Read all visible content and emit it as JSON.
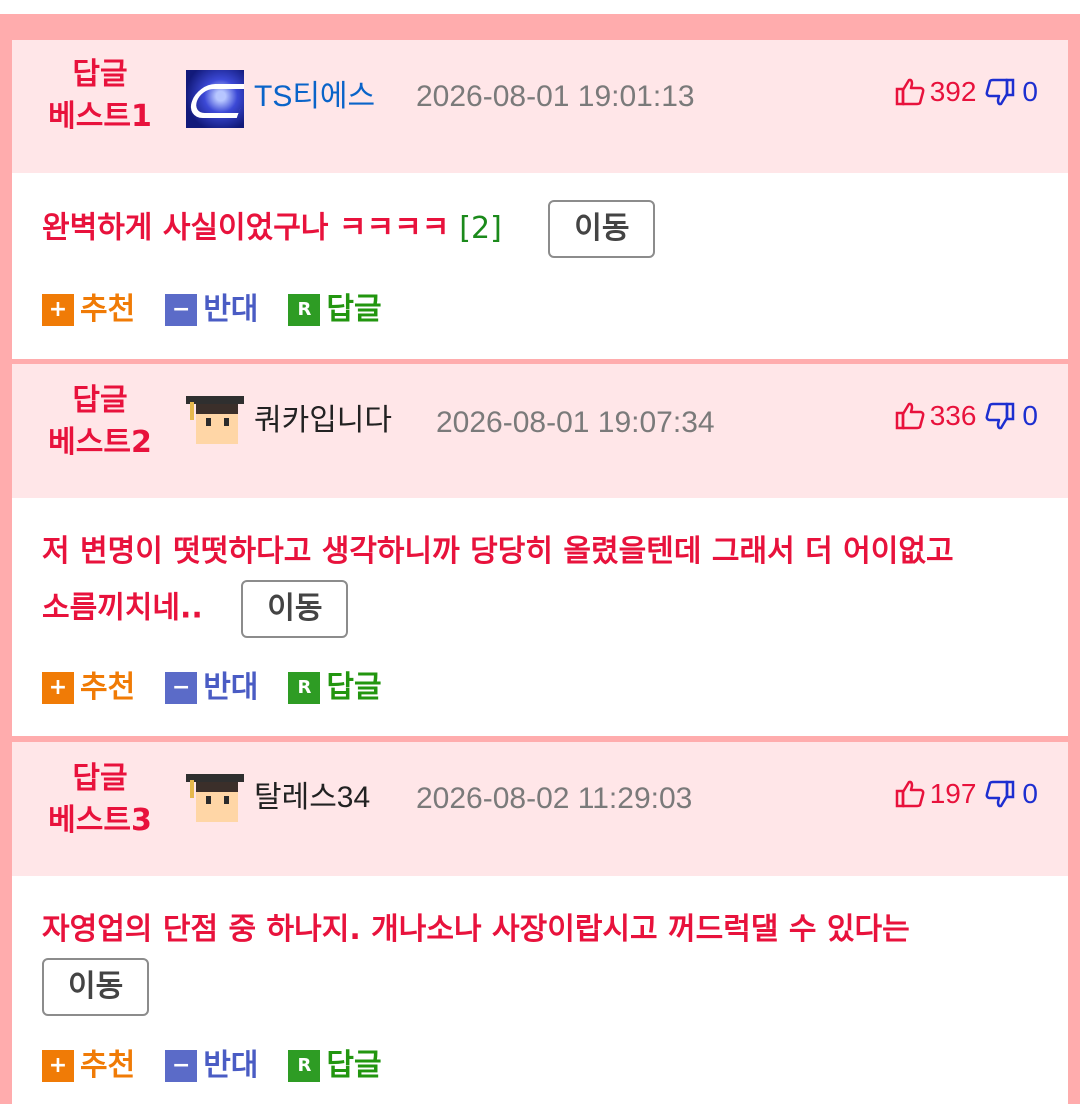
{
  "colors": {
    "frame": "#ffacad",
    "header_bg": "#ffe6e8",
    "accent_red": "#e8123c",
    "recommend": "#f07b06",
    "oppose": "#5b6bc8",
    "reply": "#2e9c24"
  },
  "comments": [
    {
      "best_line1": "답글",
      "best_line2": "베스트1",
      "avatar_icon": "ts-logo-avatar",
      "nickname": "TS티에스",
      "datetime": "2026-08-01 19:01:13",
      "upvotes": "392",
      "downvotes": "0",
      "text": "완벽하게 사실이었구나 ㅋㅋㅋㅋ",
      "reply_count": "[2]",
      "move_label": "이동",
      "recommend_label": "추천",
      "oppose_label": "반대",
      "reply_label": "답글"
    },
    {
      "best_line1": "답글",
      "best_line2": "베스트2",
      "avatar_icon": "graduate-avatar",
      "nickname": "쿼카입니다",
      "datetime": "2026-08-01 19:07:34",
      "upvotes": "336",
      "downvotes": "0",
      "text_line1": "저 변명이 떳떳하다고 생각하니까 당당히 올렸을텐데 그래서 더 어이없고",
      "text_line2": "소름끼치네..",
      "move_label": "이동",
      "recommend_label": "추천",
      "oppose_label": "반대",
      "reply_label": "답글"
    },
    {
      "best_line1": "답글",
      "best_line2": "베스트3",
      "avatar_icon": "graduate-avatar",
      "nickname": "탈레스34",
      "datetime": "2026-08-02 11:29:03",
      "upvotes": "197",
      "downvotes": "0",
      "text": "자영업의 단점 중 하나지. 개나소나 사장이랍시고 꺼드럭댈 수 있다는",
      "move_label": "이동",
      "recommend_label": "추천",
      "oppose_label": "반대",
      "reply_label": "답글"
    }
  ]
}
